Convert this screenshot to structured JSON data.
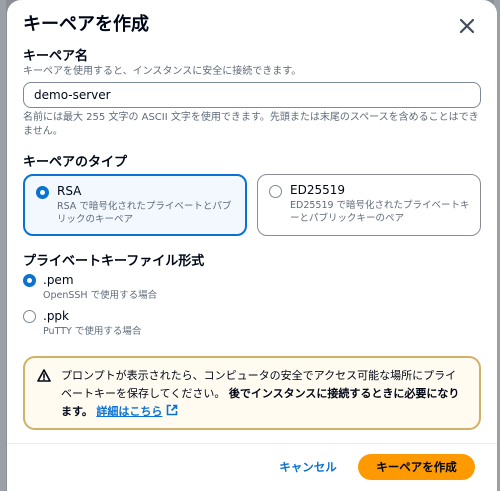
{
  "modal": {
    "title": "キーペアを作成"
  },
  "name_field": {
    "label": "キーペア名",
    "description": "キーペアを使用すると、インスタンスに安全に接続できます。",
    "value": "demo-server",
    "constraint": "名前には最大 255 文字の ASCII 文字を使用できます。先頭または末尾のスペースを含めることはできません。"
  },
  "key_type": {
    "label": "キーペアのタイプ",
    "options": [
      {
        "label": "RSA",
        "description": "RSA で暗号化されたプライベートとパブリックのキーペア",
        "selected": true
      },
      {
        "label": "ED25519",
        "description": "ED25519 で暗号化されたプライベートキーとパブリックキーのペア",
        "selected": false
      }
    ]
  },
  "file_format": {
    "label": "プライベートキーファイル形式",
    "options": [
      {
        "label": ".pem",
        "description": "OpenSSH で使用する場合",
        "selected": true
      },
      {
        "label": ".ppk",
        "description": "PuTTY で使用する場合",
        "selected": false
      }
    ]
  },
  "alert": {
    "text_plain": "プロンプトが表示されたら、コンピュータの安全でアクセス可能な場所にプライベートキーを保存してください。",
    "text_bold": "後でインスタンスに接続するときに必要になります。",
    "link": "詳細はこちら"
  },
  "footer": {
    "cancel_label": "キャンセル",
    "create_label": "キーペアを作成"
  },
  "colors": {
    "primary": "#0972d3",
    "button": "#ff9900",
    "alert_border": "#d1b06a"
  }
}
